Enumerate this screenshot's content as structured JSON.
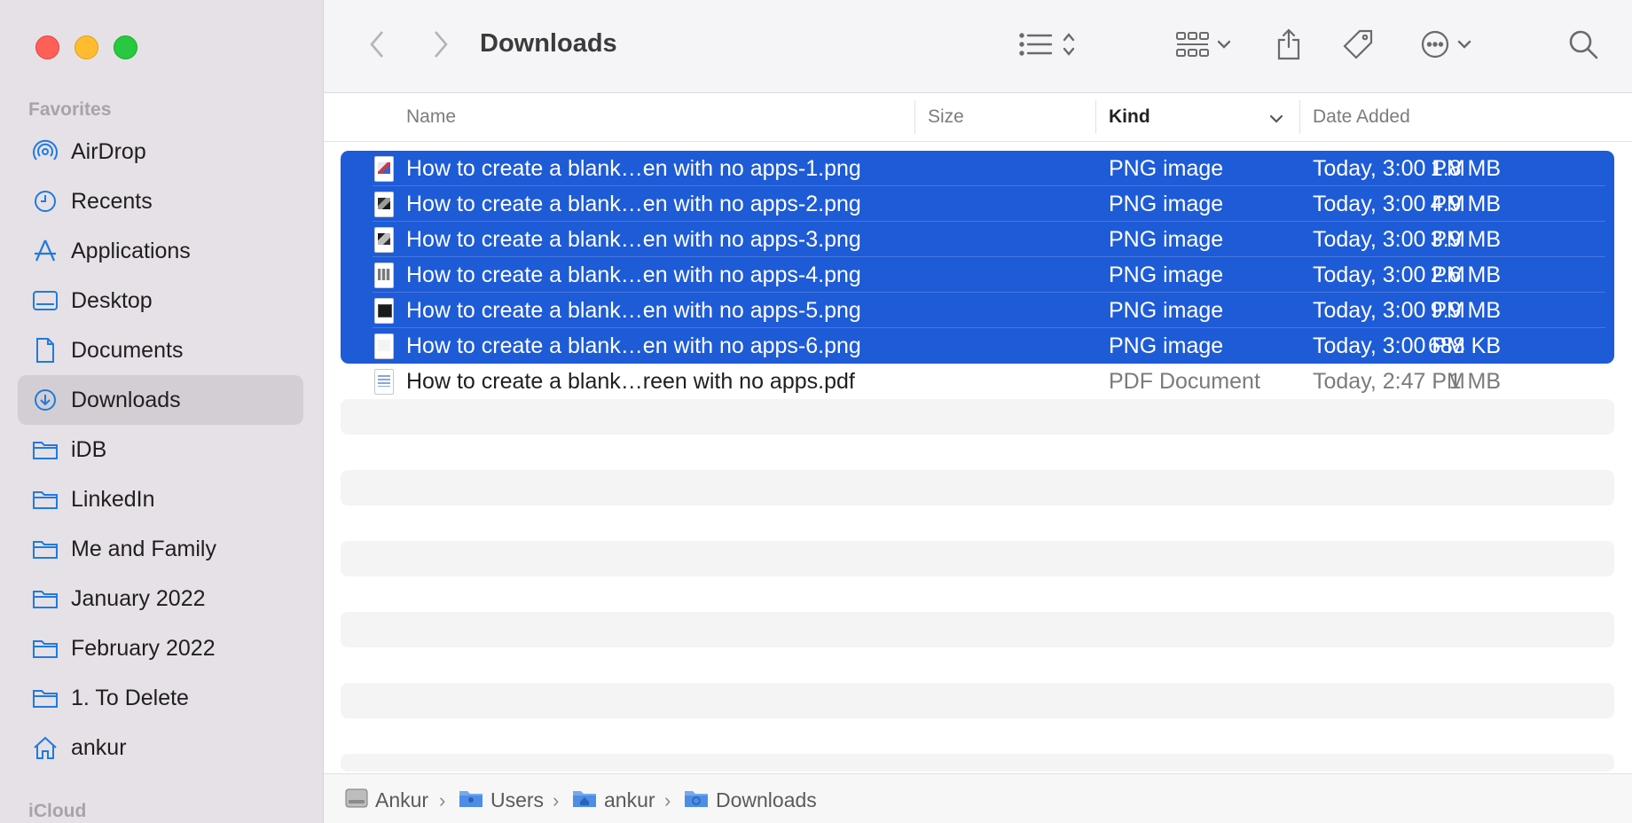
{
  "window": {
    "title": "Downloads"
  },
  "sidebar": {
    "favorites_label": "Favorites",
    "icloud_label": "iCloud",
    "items": [
      {
        "label": "AirDrop",
        "icon": "airdrop-icon"
      },
      {
        "label": "Recents",
        "icon": "clock-icon"
      },
      {
        "label": "Applications",
        "icon": "applications-icon"
      },
      {
        "label": "Desktop",
        "icon": "desktop-icon"
      },
      {
        "label": "Documents",
        "icon": "document-icon"
      },
      {
        "label": "Downloads",
        "icon": "download-icon",
        "selected": true
      },
      {
        "label": "iDB",
        "icon": "folder-icon"
      },
      {
        "label": "LinkedIn",
        "icon": "folder-icon"
      },
      {
        "label": "Me and Family",
        "icon": "folder-icon"
      },
      {
        "label": "January 2022",
        "icon": "folder-icon"
      },
      {
        "label": "February 2022",
        "icon": "folder-icon"
      },
      {
        "label": "1. To Delete",
        "icon": "folder-icon"
      },
      {
        "label": "ankur",
        "icon": "home-icon"
      }
    ]
  },
  "columns": {
    "name": "Name",
    "size": "Size",
    "kind": "Kind",
    "date_added": "Date Added"
  },
  "files": [
    {
      "name": "How to create a blank…en with no apps-1.png",
      "size": "1.8 MB",
      "kind": "PNG image",
      "date": "Today, 3:00 PM",
      "selected": true
    },
    {
      "name": "How to create a blank…en with no apps-2.png",
      "size": "4.9 MB",
      "kind": "PNG image",
      "date": "Today, 3:00 PM",
      "selected": true
    },
    {
      "name": "How to create a blank…en with no apps-3.png",
      "size": "3.9 MB",
      "kind": "PNG image",
      "date": "Today, 3:00 PM",
      "selected": true
    },
    {
      "name": "How to create a blank…en with no apps-4.png",
      "size": "2.6 MB",
      "kind": "PNG image",
      "date": "Today, 3:00 PM",
      "selected": true
    },
    {
      "name": "How to create a blank…en with no apps-5.png",
      "size": "9.9 MB",
      "kind": "PNG image",
      "date": "Today, 3:00 PM",
      "selected": true
    },
    {
      "name": "How to create a blank…en with no apps-6.png",
      "size": "688 KB",
      "kind": "PNG image",
      "date": "Today, 3:00 PM",
      "selected": true
    },
    {
      "name": "How to create a blank…reen with no apps.pdf",
      "size": "1 MB",
      "kind": "PDF Document",
      "date": "Today, 2:47 PM",
      "selected": false
    }
  ],
  "pathbar": [
    {
      "label": "Ankur",
      "icon": "hard-drive-icon"
    },
    {
      "label": "Users",
      "icon": "users-folder-icon"
    },
    {
      "label": "ankur",
      "icon": "home-folder-icon"
    },
    {
      "label": "Downloads",
      "icon": "downloads-folder-icon"
    }
  ],
  "colors": {
    "selection": "#1e5bd6",
    "accent": "#1f7ae0",
    "sidebar": "#e6e1e6"
  }
}
